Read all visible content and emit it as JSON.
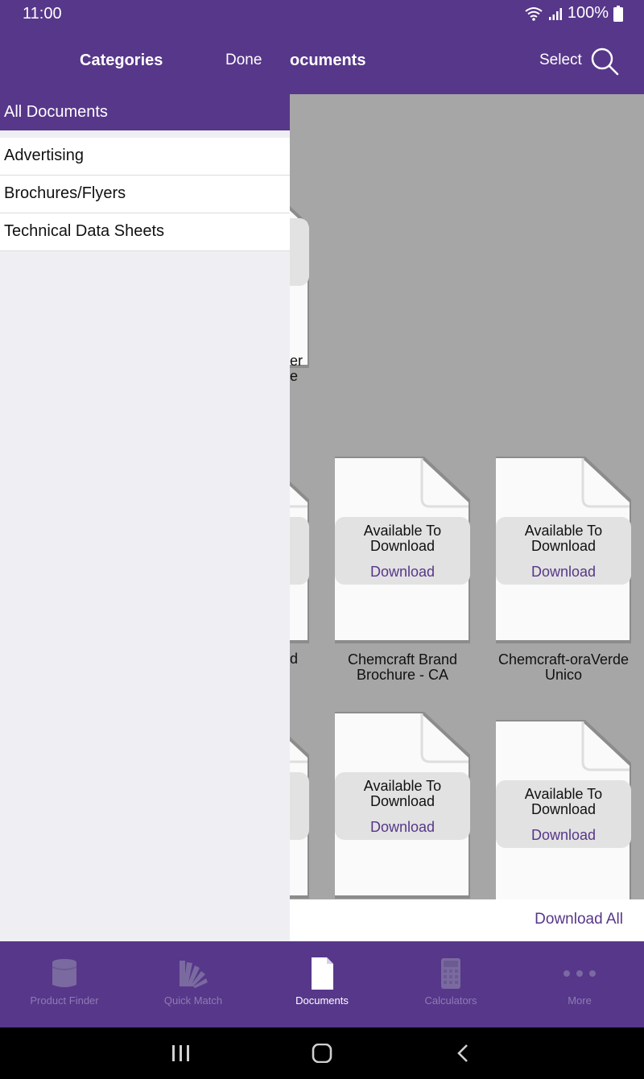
{
  "status": {
    "time": "11:00",
    "battery": "100%"
  },
  "nav": {
    "title_partial": "ocuments",
    "select_label": "Select"
  },
  "sidebar": {
    "title": "Categories",
    "done_label": "Done",
    "selected": "All Documents",
    "items": [
      {
        "label": "Advertising"
      },
      {
        "label": "Brochures/Flyers"
      },
      {
        "label": "Technical Data Sheets"
      }
    ]
  },
  "documents": {
    "available_text": "Available To Download",
    "download_label": "Download",
    "partial_captions": [
      "er",
      "e",
      "d"
    ],
    "items": [
      {
        "title": "Chemcraft Brand Brochure - CA"
      },
      {
        "title": "Chemcraft-oraVerdeUnico"
      },
      {
        "title": ""
      },
      {
        "title": ""
      }
    ],
    "download_all_label": "Download All"
  },
  "tabs": [
    {
      "label": "Product Finder",
      "icon": "paint-can-icon",
      "active": false
    },
    {
      "label": "Quick Match",
      "icon": "color-fan-icon",
      "active": false
    },
    {
      "label": "Documents",
      "icon": "document-icon",
      "active": true
    },
    {
      "label": "Calculators",
      "icon": "calculator-icon",
      "active": false
    },
    {
      "label": "More",
      "icon": "more-dots-icon",
      "active": false
    }
  ],
  "colors": {
    "brand": "#57378a",
    "content_bg": "#a6a6a6",
    "inactive_tab": "#8d7cb3"
  }
}
